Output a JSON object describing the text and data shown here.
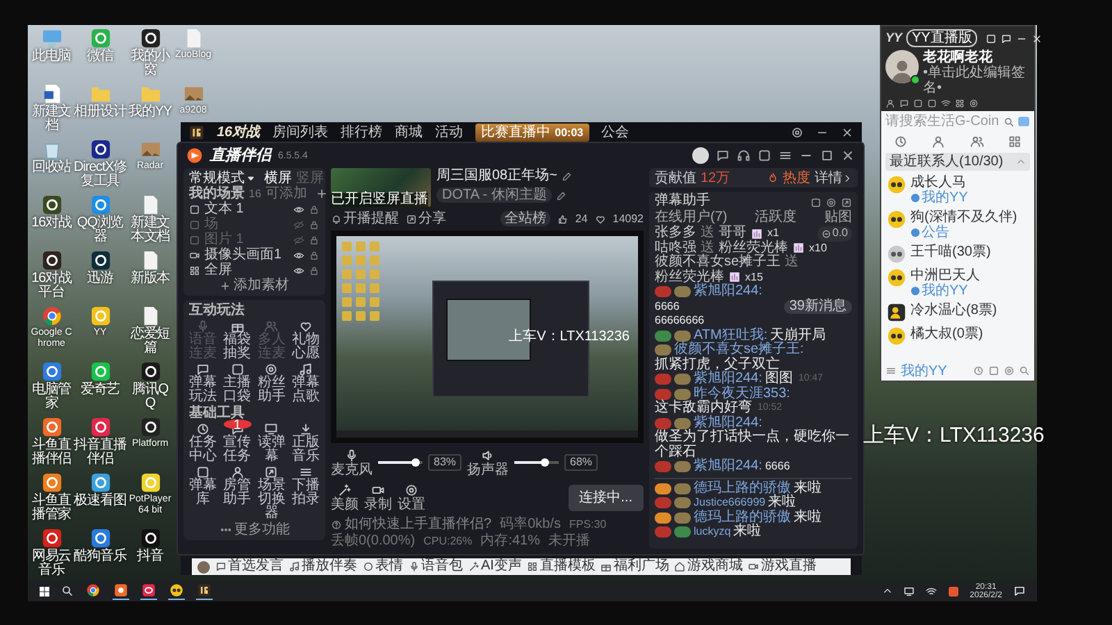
{
  "desktop_icons": [
    {
      "label": "此电脑",
      "kind": "pc"
    },
    {
      "label": "新建文档",
      "kind": "word"
    },
    {
      "label": "回收站",
      "kind": "recycle"
    },
    {
      "label": "16对战",
      "kind": "app",
      "color": "#3b4a22"
    },
    {
      "label": "16对战平台",
      "kind": "app",
      "color": "#2e2420"
    },
    {
      "label": "Google Chrome",
      "kind": "chrome"
    },
    {
      "label": "电脑管家",
      "kind": "app",
      "color": "#2f7be0"
    },
    {
      "label": "斗鱼直播伴侣",
      "kind": "app",
      "color": "#f06a2a"
    },
    {
      "label": "斗鱼直播管家",
      "kind": "app",
      "color": "#ef7d1f"
    },
    {
      "label": "网易云音乐",
      "kind": "app",
      "color": "#d7221c"
    },
    {
      "label": "微信",
      "kind": "app",
      "color": "#2bb24c"
    },
    {
      "label": "相册设计",
      "kind": "folder"
    },
    {
      "label": "DirectX修复工具",
      "kind": "app",
      "color": "#1b2a8c"
    },
    {
      "label": "QQ浏览器",
      "kind": "app",
      "color": "#1e8ee6"
    },
    {
      "label": "迅游",
      "kind": "app",
      "color": "#0f2d3a"
    },
    {
      "label": "YY",
      "kind": "app",
      "color": "#f2c21b"
    },
    {
      "label": "爱奇艺",
      "kind": "app",
      "color": "#19c34b"
    },
    {
      "label": "抖音直播伴侣",
      "kind": "app",
      "color": "#e3284a"
    },
    {
      "label": "极速看图",
      "kind": "app",
      "color": "#3aa0e0"
    },
    {
      "label": "酷狗音乐",
      "kind": "app",
      "color": "#2a7bde"
    },
    {
      "label": "我的小窝",
      "kind": "app",
      "color": "#232323"
    },
    {
      "label": "我的YY",
      "kind": "folder"
    },
    {
      "label": "Radar",
      "kind": "photo"
    },
    {
      "label": "新建文本文档",
      "kind": "file"
    },
    {
      "label": "新版本",
      "kind": "file"
    },
    {
      "label": "恋爱短篇",
      "kind": "file"
    },
    {
      "label": "腾讯QQ",
      "kind": "app",
      "color": "#1b1b1b"
    },
    {
      "label": "Platform",
      "kind": "app",
      "color": "#222222"
    },
    {
      "label": "PotPlayer 64 bit",
      "kind": "app",
      "color": "#f0d232"
    },
    {
      "label": "抖音",
      "kind": "app",
      "color": "#111111"
    },
    {
      "label": "ZuoBlog",
      "kind": "file"
    },
    {
      "label": "a9208",
      "kind": "photo"
    }
  ],
  "game_window": {
    "name": "16对战",
    "nav": [
      "房间列表",
      "排行榜",
      "商城",
      "活动",
      "公会"
    ],
    "live_badge": {
      "label": "比赛直播中",
      "time": "00:03"
    },
    "toolbar": [
      "首选发言",
      "播放伴奏",
      "表情",
      "语音包",
      "AI变声",
      "直播模板",
      "福利广场",
      "游戏商城",
      "游戏直播"
    ]
  },
  "stream_app": {
    "title": "直播伴侣",
    "version": "6.5.5.4",
    "mode": "常规模式",
    "orientations": [
      {
        "label": "横屏",
        "selected": true
      },
      {
        "label": "竖屏",
        "selected": false
      }
    ],
    "scenes": {
      "title": "我的场景",
      "count": "16",
      "hint": "可添加"
    },
    "sources": [
      {
        "label": "文本 1",
        "visible": true
      },
      {
        "label": "场",
        "visible": false
      },
      {
        "label": "图片 1",
        "visible": false
      },
      {
        "label": "摄像头画面1",
        "visible": true
      },
      {
        "label": "全屏",
        "visible": true
      }
    ],
    "add_source": "添加素材",
    "interactive": {
      "title": "互动玩法",
      "items": [
        {
          "label": "语音连麦",
          "disabled": true
        },
        {
          "label": "福袋抽奖",
          "disabled": false
        },
        {
          "label": "多人连麦",
          "disabled": true
        },
        {
          "label": "礼物心愿",
          "disabled": false
        },
        {
          "label": "弹幕玩法",
          "disabled": false
        },
        {
          "label": "主播口袋",
          "disabled": false
        },
        {
          "label": "粉丝助手",
          "disabled": false
        },
        {
          "label": "弹幕点歌",
          "disabled": false
        }
      ]
    },
    "tools": {
      "title": "基础工具",
      "items": [
        {
          "label": "任务中心"
        },
        {
          "label": "宣传任务",
          "badge": "1"
        },
        {
          "label": "读弹幕"
        },
        {
          "label": "正版音乐"
        },
        {
          "label": "弹幕库"
        },
        {
          "label": "房管助手"
        },
        {
          "label": "场景切换器"
        },
        {
          "label": "下播拍录"
        }
      ]
    },
    "more": "更多功能",
    "cover_caption": "已开启竖屏直播",
    "stream_title": "周三国服08正年场~",
    "category": "DOTA - 休闲主题",
    "actions": [
      "开播提醒",
      "分享"
    ],
    "stats": {
      "rank": "全站榜",
      "likes": "24",
      "hearts": "14092"
    },
    "preview_caption": "上车V：LTX113236",
    "audio": [
      {
        "kind": "mic",
        "label": "麦克风",
        "level": 0.83,
        "reading": "83%"
      },
      {
        "kind": "speaker",
        "label": "扬声器",
        "level": 0.68,
        "reading": "68%"
      }
    ],
    "tools_bar": [
      "美颜",
      "录制",
      "设置"
    ],
    "connect": "连接中...",
    "status": {
      "help": "如何快速上手直播伴侣?",
      "items": [
        "码率0kb/s",
        "FPS:30",
        "丢帧0(0.00%)",
        "CPU:26%",
        "内存:41%",
        "未开播"
      ]
    },
    "contribution": {
      "label": "贡献值",
      "value": "12万",
      "heat": "热度",
      "details": "详情"
    },
    "danmu": {
      "title": "弹幕助手",
      "tabs": [
        "在线用户(7)",
        "活跃度",
        "贴图"
      ],
      "total": "0.0",
      "new_messages": "39新消息",
      "gifts": [
        {
          "sender": "张多多",
          "verb": "送",
          "gift": "哥哥",
          "count": "x1"
        },
        {
          "sender": "咕咚强",
          "verb": "送",
          "gift": "粉丝荧光棒",
          "count": "x10"
        },
        {
          "sender": "彼颜不喜女se摊子王",
          "verb": "送",
          "gift": "粉丝荧光棒",
          "count": "x15"
        }
      ],
      "messages": [
        {
          "badges": [
            {
              "color": "#b8322c"
            },
            {
              "color": "#8c7a4c"
            }
          ],
          "user": "紫旭阳244:",
          "text": "6666"
        },
        {
          "text": "66666666"
        },
        {
          "badges": [
            {
              "color": "#3d8a4a"
            },
            {
              "color": "#8c7a4c"
            }
          ],
          "user": "ATM狂吐我:",
          "text": "天崩开局"
        },
        {
          "badges": [
            {
              "color": "#8c7a4c"
            }
          ],
          "user": "彼颜不喜女se摊子王:",
          "text": "抓紧打虎，父子双亡"
        },
        {
          "badges": [
            {
              "color": "#b8322c"
            },
            {
              "color": "#8c7a4c"
            }
          ],
          "user": "紫旭阳244:",
          "text": "图图",
          "time": "10:47"
        },
        {
          "badges": [
            {
              "color": "#b8322c"
            },
            {
              "color": "#8c7a4c"
            }
          ],
          "user": "昨今夜天涯353:",
          "text": "这卡敌霸内好弯",
          "time": "10:52"
        },
        {
          "badges": [
            {
              "color": "#b8322c"
            },
            {
              "color": "#8c7a4c"
            }
          ],
          "user": "紫旭阳244:",
          "text": "做圣为了打话快一点，硬吃你一个踩石"
        },
        {
          "badges": [
            {
              "color": "#b8322c"
            },
            {
              "color": "#8c7a4c"
            }
          ],
          "user": "紫旭阳244:",
          "text": "6666"
        }
      ],
      "entries": [
        {
          "badges": [
            {
              "color": "#e08a2a"
            },
            {
              "color": "#8c7a4c"
            }
          ],
          "user": "德玛上路的骄傲",
          "text": "来啦"
        },
        {
          "badges": [
            {
              "color": "#b8322c"
            },
            {
              "color": "#8c7a4c"
            }
          ],
          "user": "Justice666999",
          "text": "来啦"
        },
        {
          "badges": [
            {
              "color": "#e08a2a"
            },
            {
              "color": "#8c7a4c"
            }
          ],
          "user": "德玛上路的骄傲",
          "text": "来啦"
        },
        {
          "badges": [
            {
              "color": "#b8322c"
            },
            {
              "color": "#3d8a4a"
            }
          ],
          "user": "luckyzq",
          "text": "来啦"
        }
      ]
    }
  },
  "overlay_caption": "上车V：LTX113236",
  "yy_panel": {
    "brand": "YY",
    "edition": "YY直播版",
    "name": "老花啊老花",
    "signature": "•单击此处编辑签名•",
    "online": true,
    "search_placeholder": "请搜索生活G-Coin",
    "group": "最近联系人(10/30)",
    "contacts": [
      {
        "name": "成长人马",
        "status": "我的YY",
        "kind": "yy"
      },
      {
        "name": "狗(深情不及久伴)",
        "status": "公告",
        "kind": "yy"
      },
      {
        "name": "王千喵(30票)",
        "kind": "offline"
      },
      {
        "name": "中洲巴天人",
        "status": "我的YY",
        "kind": "yy"
      },
      {
        "name": "冷水温心(8票)",
        "kind": "group"
      },
      {
        "name": "橘大叔(0票)",
        "kind": "yy"
      }
    ],
    "footer": "我的YY"
  },
  "taskbar": {
    "apps": [
      {
        "kind": "chrome",
        "running": false
      },
      {
        "kind": "douyu",
        "running": true
      },
      {
        "kind": "douyin",
        "running": true
      },
      {
        "kind": "yy",
        "running": true
      },
      {
        "kind": "game",
        "running": true
      }
    ],
    "time": "20:31",
    "date": "2026/2/2"
  }
}
